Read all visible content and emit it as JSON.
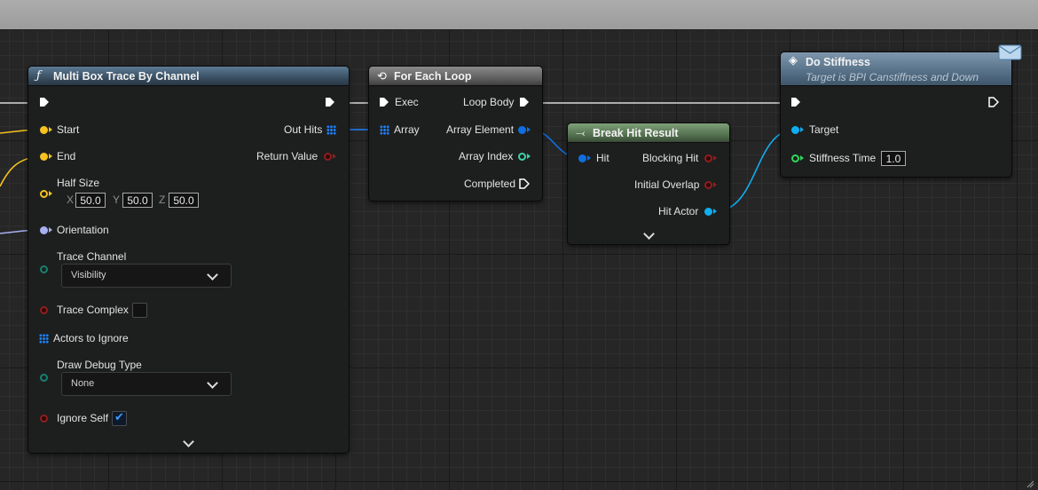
{
  "nodes": {
    "multi_box_trace": {
      "title": "Multi Box Trace By Channel",
      "icon": "function-icon",
      "pins": {
        "start": "Start",
        "end": "End",
        "half_size": "Half Size",
        "orientation": "Orientation",
        "trace_channel": "Trace Channel",
        "trace_complex": "Trace Complex",
        "actors_to_ignore": "Actors to Ignore",
        "draw_debug_type": "Draw Debug Type",
        "ignore_self": "Ignore Self",
        "out_hits": "Out Hits",
        "return_value": "Return Value"
      },
      "half_size": {
        "x_label": "X",
        "x": "50.0",
        "y_label": "Y",
        "y": "50.0",
        "z_label": "Z",
        "z": "50.0"
      },
      "trace_channel_value": "Visibility",
      "draw_debug_type_value": "None",
      "trace_complex_checked": false,
      "ignore_self_checked": true
    },
    "for_each_loop": {
      "title": "For Each Loop",
      "icon": "loop-macro-icon",
      "pins": {
        "exec": "Exec",
        "array": "Array",
        "loop_body": "Loop Body",
        "array_element": "Array Element",
        "array_index": "Array Index",
        "completed": "Completed"
      }
    },
    "break_hit_result": {
      "title": "Break Hit Result",
      "icon": "break-struct-icon",
      "pins": {
        "hit": "Hit",
        "blocking_hit": "Blocking Hit",
        "initial_overlap": "Initial Overlap",
        "hit_actor": "Hit Actor"
      }
    },
    "do_stiffness": {
      "title": "Do Stiffness",
      "subtitle": "Target is BPI Canstiffness and Down",
      "icon": "interface-message-icon",
      "pins": {
        "target": "Target",
        "stiffness_time": "Stiffness Time"
      },
      "stiffness_time_value": "1.0"
    }
  },
  "colors": {
    "exec_wire": "#ffffff",
    "vector_pin": "#f6c21f",
    "rotator_pin": "#a7b0f0",
    "object_pin": "#10aef0",
    "struct_pin": "#0e6fe0",
    "bool_pin": "#8f1e1e",
    "float_pin": "#2ed85d"
  }
}
